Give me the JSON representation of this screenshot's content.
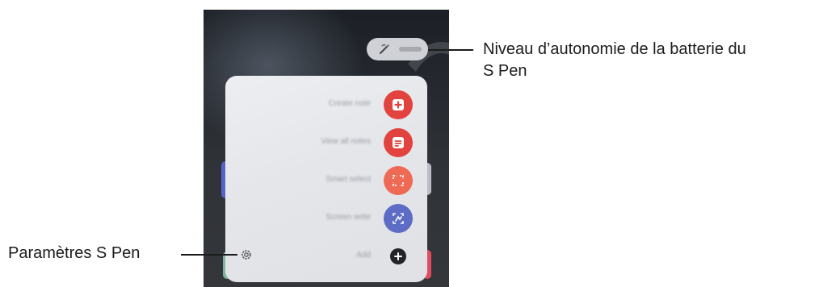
{
  "callouts": {
    "battery_level_line1": "Niveau d’autonomie de la batterie du",
    "battery_level_line2": "S Pen",
    "settings": "Paramètres S Pen"
  },
  "air_command": {
    "items": [
      {
        "label": "Create note",
        "icon": "add-note-icon",
        "color": "#e3433f"
      },
      {
        "label": "View all notes",
        "icon": "notes-list-icon",
        "color": "#e3433f"
      },
      {
        "label": "Smart select",
        "icon": "smart-select-icon",
        "color": "#ee6a55"
      },
      {
        "label": "Screen write",
        "icon": "screen-write-icon",
        "color": "#5d6cc4"
      },
      {
        "label": "Add",
        "icon": "plus-icon",
        "color": "#222427"
      }
    ],
    "settings_icon": "gear-icon"
  },
  "battery_chip": {
    "icon": "s-pen-icon"
  }
}
